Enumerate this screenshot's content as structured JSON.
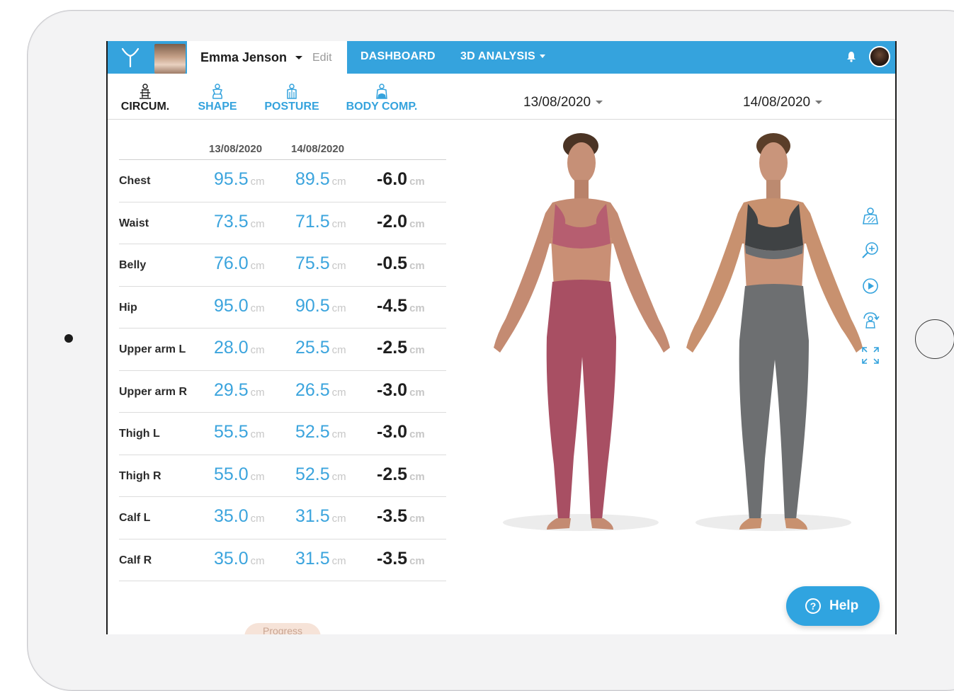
{
  "app": {
    "user_name": "Emma Jenson",
    "edit_label": "Edit",
    "nav": [
      {
        "label": "DASHBOARD"
      },
      {
        "label": "3D ANALYSIS"
      }
    ]
  },
  "tabs": [
    {
      "label": "CIRCUM.",
      "icon": "tape-measure-icon",
      "active": true
    },
    {
      "label": "SHAPE",
      "icon": "body-shape-icon",
      "active": false
    },
    {
      "label": "POSTURE",
      "icon": "posture-icon",
      "active": false
    },
    {
      "label": "BODY COMP.",
      "icon": "body-composition-icon",
      "active": false
    }
  ],
  "dates": {
    "left": "13/08/2020",
    "right": "14/08/2020"
  },
  "table": {
    "headers": [
      "13/08/2020",
      "14/08/2020"
    ],
    "unit": "cm",
    "rows": [
      {
        "label": "Chest",
        "v1": "95.5",
        "v2": "89.5",
        "diff": "-6.0"
      },
      {
        "label": "Waist",
        "v1": "73.5",
        "v2": "71.5",
        "diff": "-2.0"
      },
      {
        "label": "Belly",
        "v1": "76.0",
        "v2": "75.5",
        "diff": "-0.5"
      },
      {
        "label": "Hip",
        "v1": "95.0",
        "v2": "90.5",
        "diff": "-4.5"
      },
      {
        "label": "Upper arm L",
        "v1": "28.0",
        "v2": "25.5",
        "diff": "-2.5"
      },
      {
        "label": "Upper arm R",
        "v1": "29.5",
        "v2": "26.5",
        "diff": "-3.0"
      },
      {
        "label": "Thigh L",
        "v1": "55.5",
        "v2": "52.5",
        "diff": "-3.0"
      },
      {
        "label": "Thigh R",
        "v1": "55.0",
        "v2": "52.5",
        "diff": "-2.5"
      },
      {
        "label": "Calf L",
        "v1": "35.0",
        "v2": "31.5",
        "diff": "-3.5"
      },
      {
        "label": "Calf R",
        "v1": "35.0",
        "v2": "31.5",
        "diff": "-3.5"
      }
    ]
  },
  "side_tools": [
    "body-scan-icon",
    "zoom-in-icon",
    "play-icon",
    "rotate-icon",
    "fullscreen-icon"
  ],
  "help": {
    "label": "Help",
    "icon": "?"
  },
  "progress": {
    "label": "Progress"
  },
  "colors": {
    "accent": "#35a3dd",
    "value_blue": "#3ba4dd",
    "outfit_left": "#a84f63",
    "outfit_right": "#6d6f71"
  }
}
